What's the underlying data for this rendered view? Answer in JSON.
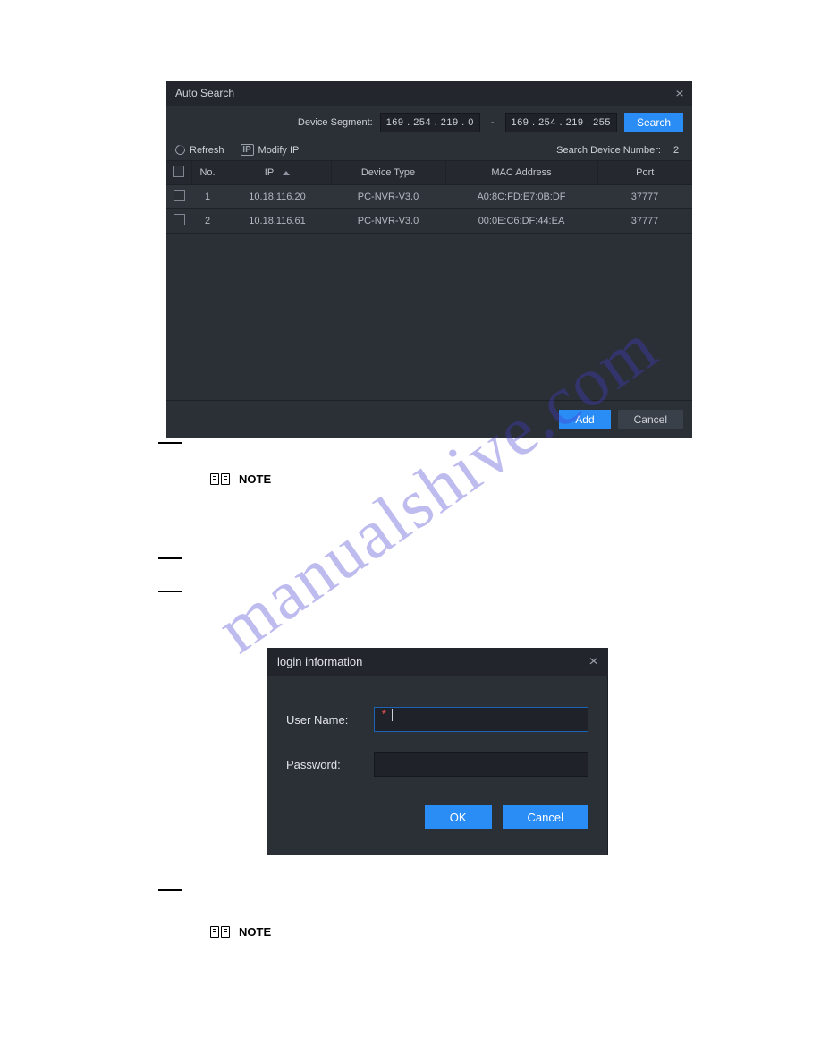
{
  "watermark": "manualshive.com",
  "auto_search": {
    "title": "Auto Search",
    "segment_label": "Device Segment:",
    "start_ip": "169 . 254 . 219 .   0",
    "end_ip": "169 . 254 . 219 . 255",
    "search_btn": "Search",
    "refresh": "Refresh",
    "modify_ip": "Modify IP",
    "sdn_label": "Search Device Number:",
    "sdn_value": "2",
    "headers": {
      "no": "No.",
      "ip": "IP",
      "type": "Device Type",
      "mac": "MAC Address",
      "port": "Port"
    },
    "rows": [
      {
        "no": "1",
        "ip": "10.18.116.20",
        "type": "PC-NVR-V3.0",
        "mac": "A0:8C:FD:E7:0B:DF",
        "port": "37777"
      },
      {
        "no": "2",
        "ip": "10.18.116.61",
        "type": "PC-NVR-V3.0",
        "mac": "00:0E:C6:DF:44:EA",
        "port": "37777"
      }
    ],
    "add_btn": "Add",
    "cancel_btn": "Cancel"
  },
  "notes": {
    "label": "NOTE"
  },
  "login": {
    "title": "login information",
    "user_label": "User Name:",
    "pass_label": "Password:",
    "ok": "OK",
    "cancel": "Cancel"
  }
}
